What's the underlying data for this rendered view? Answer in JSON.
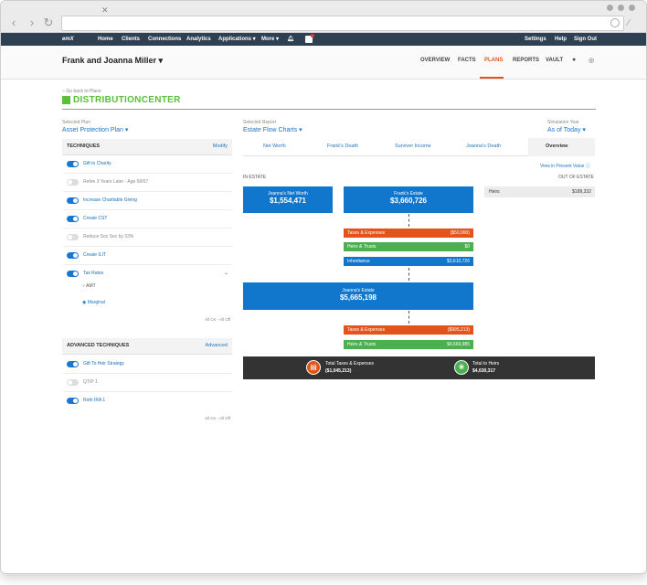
{
  "brand": "emX",
  "topnav": {
    "items": [
      "Home",
      "Clients",
      "Connections",
      "Analytics",
      "Applications ▾",
      "More ▾"
    ],
    "right": [
      "Settings",
      "Help",
      "Sign Out"
    ]
  },
  "header": {
    "client": "Frank and Joanna Miller",
    "tabs": [
      "OVERVIEW",
      "FACTS",
      "PLANS",
      "REPORTS",
      "VAULT"
    ]
  },
  "page": {
    "back_link": "Go back to Plans",
    "title": "DISTRIBUTIONCENTER",
    "selected_plan_label": "Selected Plan",
    "selected_plan": "Asset Protection Plan",
    "selected_report_label": "Selected Report",
    "selected_report": "Estate Flow Charts",
    "sim_year_label": "Simulation Year",
    "sim_year": "As of Today"
  },
  "techniques": {
    "header": "TECHNIQUES",
    "modify": "Modify",
    "items": [
      {
        "label": "Gift to Charity",
        "on": true
      },
      {
        "label": "Retire 3 Years Later - Age 68/67",
        "on": false
      },
      {
        "label": "Increase Charitable Giving",
        "on": true
      },
      {
        "label": "Create CST",
        "on": true
      },
      {
        "label": "Reduce Soc Sec by 33%",
        "on": false
      },
      {
        "label": "Create ILIT",
        "on": true
      },
      {
        "label": "Tax Rates",
        "on": true
      }
    ],
    "radio_amt": "AMT",
    "radio_marginal": "Marginal",
    "all_toggle": "All On - All Off"
  },
  "advanced": {
    "header": "ADVANCED TECHNIQUES",
    "link": "Advanced",
    "items": [
      {
        "label": "Gift To Heir Strategy",
        "on": true
      },
      {
        "label": "QTIP 1",
        "on": false
      },
      {
        "label": "Roth IRA 1",
        "on": true
      }
    ],
    "all_toggle": "All On - All Off"
  },
  "report_tabs": [
    "Net Worth",
    "Frank's Death",
    "Survivor Income",
    "Joanna's Death",
    "Overview"
  ],
  "present_value_link": "View in Present Value",
  "flow": {
    "in_estate": "IN ESTATE",
    "out_of_estate": "OUT OF ESTATE",
    "joanna_nw_label": "Joanna's Net Worth",
    "joanna_nw_value": "$1,554,471",
    "frank_estate_label": "Frank's Estate",
    "frank_estate_value": "$3,660,726",
    "taxes1_label": "Taxes & Expenses",
    "taxes1_value": "($50,000)",
    "heirs1_label": "Heirs & Trusts",
    "heirs1_value": "$0",
    "inherit_label": "Inheritance",
    "inherit_value": "$3,610,726",
    "joanna_estate_label": "Joanna's Estate",
    "joanna_estate_value": "$5,665,198",
    "taxes2_label": "Taxes & Expenses",
    "taxes2_value": "($995,213)",
    "heirs2_label": "Heirs & Trusts",
    "heirs2_value": "$4,669,985",
    "total_tax_label": "Total Taxes & Expenses",
    "total_tax_value": "($1,045,213)",
    "total_heirs_label": "Total to Heirs",
    "total_heirs_value": "$4,630,317",
    "out_row_label": "Heirs",
    "out_row_value": "$189,332"
  },
  "colors": {
    "navy": "#2e4052",
    "blue": "#1177cc",
    "orange": "#e2541b",
    "green": "#4caf50",
    "dark": "#333333",
    "accent_green": "#5bbf3a"
  }
}
